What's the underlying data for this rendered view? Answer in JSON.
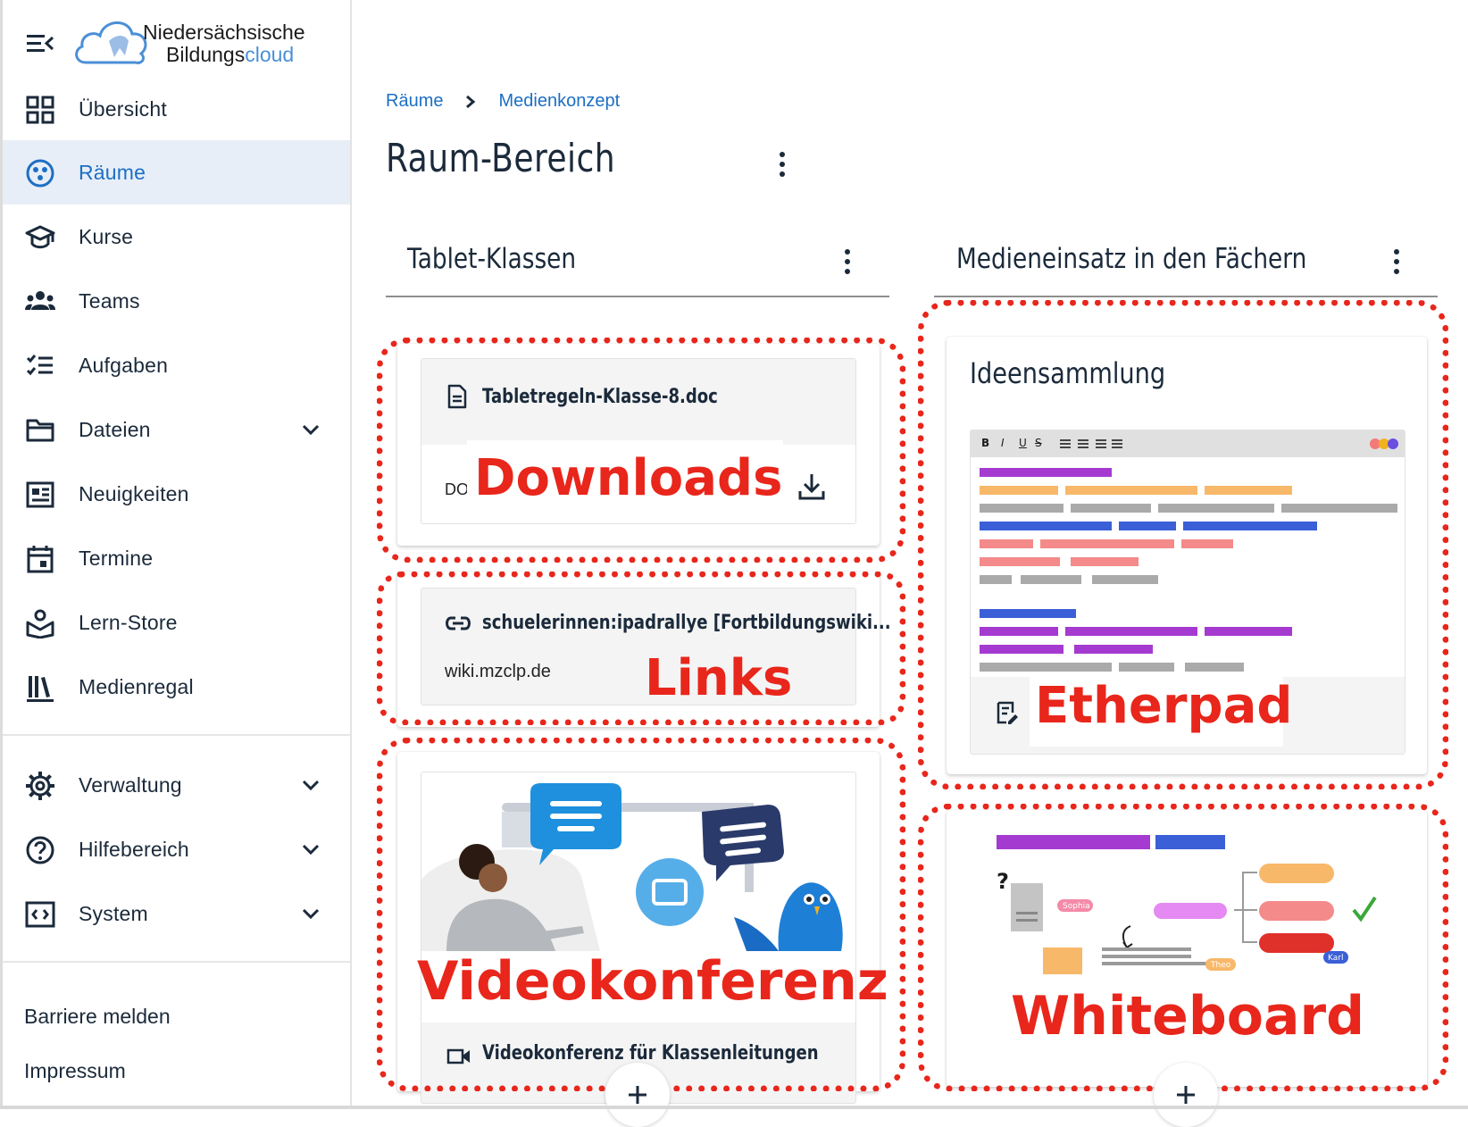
{
  "sidebar": {
    "logo": {
      "line1": "Niedersächsische",
      "line2_a": "Bildungs",
      "line2_b": "cloud"
    },
    "items": [
      {
        "label": "Übersicht",
        "icon": "dashboard-icon"
      },
      {
        "label": "Räume",
        "icon": "rooms-icon",
        "active": true
      },
      {
        "label": "Kurse",
        "icon": "school-icon"
      },
      {
        "label": "Teams",
        "icon": "teams-icon"
      },
      {
        "label": "Aufgaben",
        "icon": "tasks-icon"
      },
      {
        "label": "Dateien",
        "icon": "folder-icon",
        "expandable": true
      },
      {
        "label": "Neuigkeiten",
        "icon": "news-icon"
      },
      {
        "label": "Termine",
        "icon": "calendar-icon"
      },
      {
        "label": "Lern-Store",
        "icon": "learnstore-icon"
      },
      {
        "label": "Medienregal",
        "icon": "media-shelf-icon"
      },
      {
        "label": "Verwaltung",
        "icon": "gear-icon",
        "expandable": true
      },
      {
        "label": "Hilfebereich",
        "icon": "help-icon",
        "expandable": true
      },
      {
        "label": "System",
        "icon": "system-icon",
        "expandable": true
      }
    ],
    "footer": [
      "Barriere melden",
      "Impressum"
    ]
  },
  "breadcrumb": [
    "Räume",
    "Medienkonzept"
  ],
  "page_title": "Raum-Bereich",
  "columns": [
    {
      "title": "Tablet-Klassen"
    },
    {
      "title": "Medieneinsatz in den Fächern"
    }
  ],
  "cards": {
    "file": {
      "name": "Tabletregeln-Klasse-8.doc",
      "type_prefix": "DO",
      "annotation": "Downloads"
    },
    "link": {
      "title": "schuelerinnen:ipadrallye [Fortbildungswiki...",
      "url": "wiki.mzclp.de",
      "annotation": "Links"
    },
    "video": {
      "title": "Videokonferenz für Klassenleitungen",
      "annotation": "Videokonferenz"
    },
    "etherpad": {
      "title": "Ideensammlung",
      "annotation": "Etherpad",
      "toolbar": [
        "B",
        "I",
        "U",
        "S"
      ]
    },
    "whiteboard": {
      "annotation": "Whiteboard",
      "tags": [
        "Sophia",
        "Theo",
        "Karl"
      ]
    }
  },
  "colors": {
    "accent": "#1d6fc4",
    "annotation": "#e8261b",
    "active_bg": "#e8eef7"
  }
}
